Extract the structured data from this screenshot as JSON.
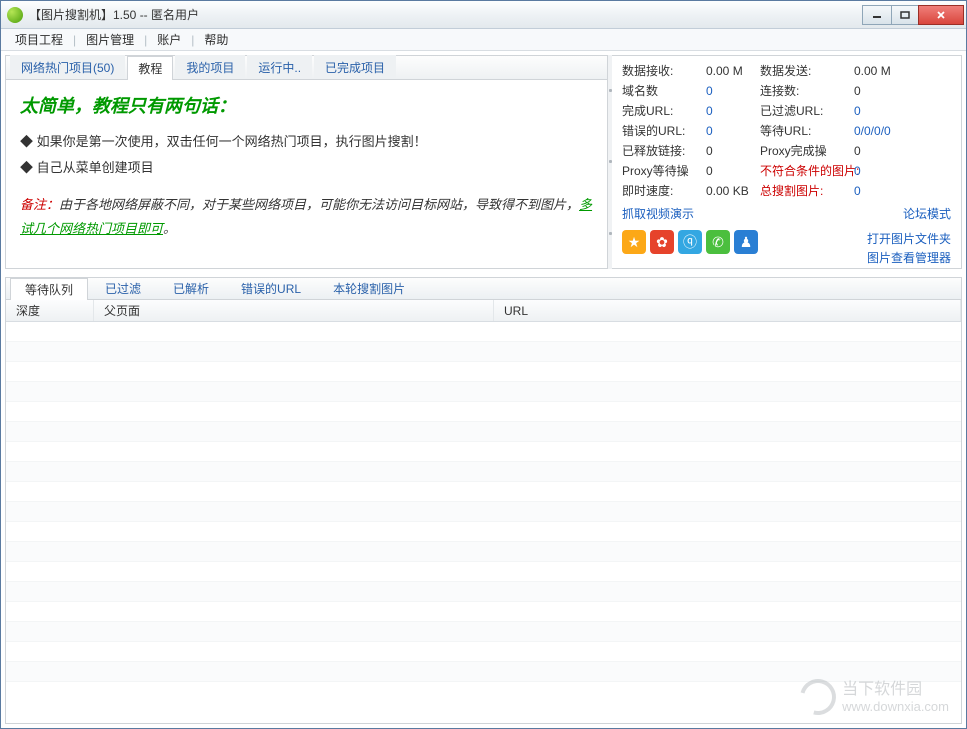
{
  "window": {
    "title": "【图片搜割机】1.50 -- 匿名用户"
  },
  "menu": {
    "items": [
      "项目工程",
      "图片管理",
      "账户",
      "帮助"
    ]
  },
  "topTabs": {
    "items": [
      "网络热门项目(50)",
      "教程",
      "我的项目",
      "运行中..",
      "已完成项目"
    ],
    "activeIndex": 1
  },
  "tutorial": {
    "heading": "太简单，教程只有两句话：",
    "line1": "◆ 如果你是第一次使用，双击任何一个网络热门项目，执行图片搜割！",
    "line2": "◆ 自己从菜单创建项目",
    "noteLabel": "备注：",
    "noteTextA": "由于各地网络屏蔽不同，对于某些网络项目，可能你无法访问目标网站，导致得不到图片，",
    "noteLink": "多试几个网络热门项目即可",
    "noteTextB": "。"
  },
  "stats": {
    "rows": [
      {
        "l1": "数据接收:",
        "v1": "0.00 M",
        "l2": "数据发送:",
        "v2": "0.00 M"
      },
      {
        "l1": "域名数",
        "v1": "0",
        "v1link": true,
        "l2": "连接数:",
        "v2": "0"
      },
      {
        "l1": "完成URL:",
        "v1": "0",
        "v1link": true,
        "l2": "已过滤URL:",
        "v2": "0",
        "v2link": true
      },
      {
        "l1": "错误的URL:",
        "v1": "0",
        "v1link": true,
        "l2": "等待URL:",
        "v2": "0/0/0/0",
        "v2link": true
      },
      {
        "l1": "已释放链接:",
        "v1": "0",
        "l2": "Proxy完成操",
        "v2": "0"
      },
      {
        "l1": "Proxy等待操",
        "v1": "0",
        "l2": "不符合条件的图片:",
        "v2": "0",
        "l2red": true,
        "v2link": true
      },
      {
        "l1": "即时速度:",
        "v1": "0.00 KB",
        "l2": "总搜割图片:",
        "v2": "0",
        "l2red": true,
        "v2link": true
      }
    ],
    "videoDemo": "抓取视频演示",
    "forumMode": "论坛模式",
    "openFolder": "打开图片文件夹",
    "viewManager": "图片查看管理器"
  },
  "social": {
    "icons": [
      {
        "name": "qzone-icon",
        "bg": "#fca817",
        "glyph": "★"
      },
      {
        "name": "weibo-icon",
        "bg": "#e6432b",
        "glyph": "✿"
      },
      {
        "name": "tencent-icon",
        "bg": "#33a7e2",
        "glyph": "ⓠ"
      },
      {
        "name": "wechat-icon",
        "bg": "#4bbf3e",
        "glyph": "✆"
      },
      {
        "name": "renren-icon",
        "bg": "#2a7fd4",
        "glyph": "♟"
      }
    ]
  },
  "queueTabs": {
    "items": [
      "等待队列",
      "已过滤",
      "已解析",
      "错误的URL",
      "本轮搜割图片"
    ],
    "activeIndex": 0
  },
  "queueHeader": {
    "depth": "深度",
    "parent": "父页面",
    "url": "URL"
  },
  "watermark": {
    "cn": "当下软件园",
    "en": "www.downxia.com"
  }
}
